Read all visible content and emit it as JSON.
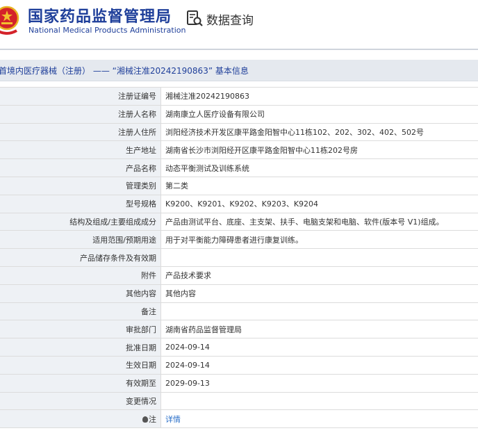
{
  "header": {
    "agency_name_cn": "国家药品监督管理局",
    "agency_name_en": "National Medical Products Administration",
    "search_label": "数据查询"
  },
  "breadcrumb": {
    "text": "首境内医疗器械（注册） —— “湘械注准20242190863” 基本信息"
  },
  "rows": [
    {
      "label": "注册证编号",
      "value": "湘械注准20242190863"
    },
    {
      "label": "注册人名称",
      "value": "湖南康立人医疗设备有限公司"
    },
    {
      "label": "注册人住所",
      "value": "浏阳经济技术开发区康平路金阳智中心11栋102、202、302、402、502号"
    },
    {
      "label": "生产地址",
      "value": "湖南省长沙市浏阳经开区康平路金阳智中心11栋202号房"
    },
    {
      "label": "产品名称",
      "value": "动态平衡测试及训练系统"
    },
    {
      "label": "管理类别",
      "value": "第二类"
    },
    {
      "label": "型号规格",
      "value": "K9200、K9201、K9202、K9203、K9204"
    },
    {
      "label": "结构及组成/主要组成成分",
      "value": "产品由测试平台、底座、主支架、扶手、电脑支架和电脑、软件(版本号 V1)组成。"
    },
    {
      "label": "适用范围/预期用途",
      "value": "用于对平衡能力障碍患者进行康复训练。"
    },
    {
      "label": "产品储存条件及有效期",
      "value": ""
    },
    {
      "label": "附件",
      "value": "产品技术要求"
    },
    {
      "label": "其他内容",
      "value": "其他内容"
    },
    {
      "label": "备注",
      "value": ""
    },
    {
      "label": "审批部门",
      "value": "湖南省药品监督管理局"
    },
    {
      "label": "批准日期",
      "value": "2024-09-14"
    },
    {
      "label": "生效日期",
      "value": "2024-09-14"
    },
    {
      "label": "有效期至",
      "value": "2029-09-13"
    },
    {
      "label": "变更情况",
      "value": ""
    },
    {
      "label": "注",
      "value": "详情"
    }
  ]
}
